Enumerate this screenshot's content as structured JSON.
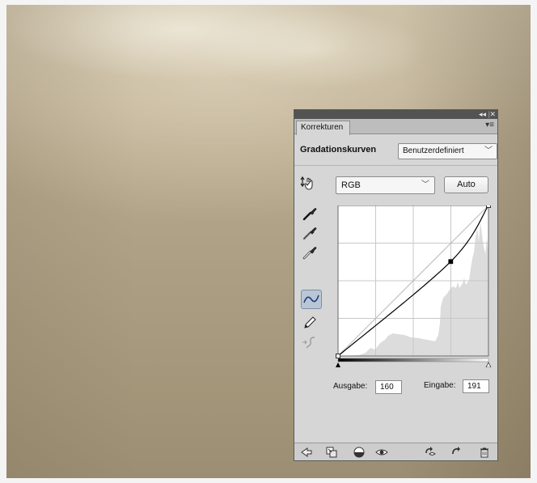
{
  "panel": {
    "tab_label": "Korrekturen",
    "adjustment_title": "Gradationskurven",
    "preset_value": "Benutzerdefiniert",
    "channel_value": "RGB",
    "auto_label": "Auto",
    "output_label": "Ausgabe:",
    "output_value": "160",
    "input_label": "Eingabe:",
    "input_value": "191"
  },
  "curve": {
    "points": [
      [
        0,
        0
      ],
      [
        191,
        160
      ],
      [
        255,
        255
      ]
    ]
  },
  "icons": {
    "titlebar": [
      "collapse-icon",
      "close-icon"
    ],
    "tab_menu": "panel-menu-icon",
    "tools": [
      "on-image-adjust-icon",
      "black-point-eyedropper-icon",
      "gray-point-eyedropper-icon",
      "white-point-eyedropper-icon",
      "curve-points-icon",
      "pencil-icon",
      "smooth-curve-icon"
    ],
    "bottom": [
      "back-arrow-icon",
      "expand-view-icon",
      "clip-layer-icon",
      "visibility-eye-icon",
      "previous-state-icon",
      "reset-icon",
      "delete-icon"
    ]
  },
  "colors": {
    "panel_bg": "#d6d6d6",
    "titlebar_bg": "#535353",
    "selected_tool": "#b9c6d6"
  }
}
